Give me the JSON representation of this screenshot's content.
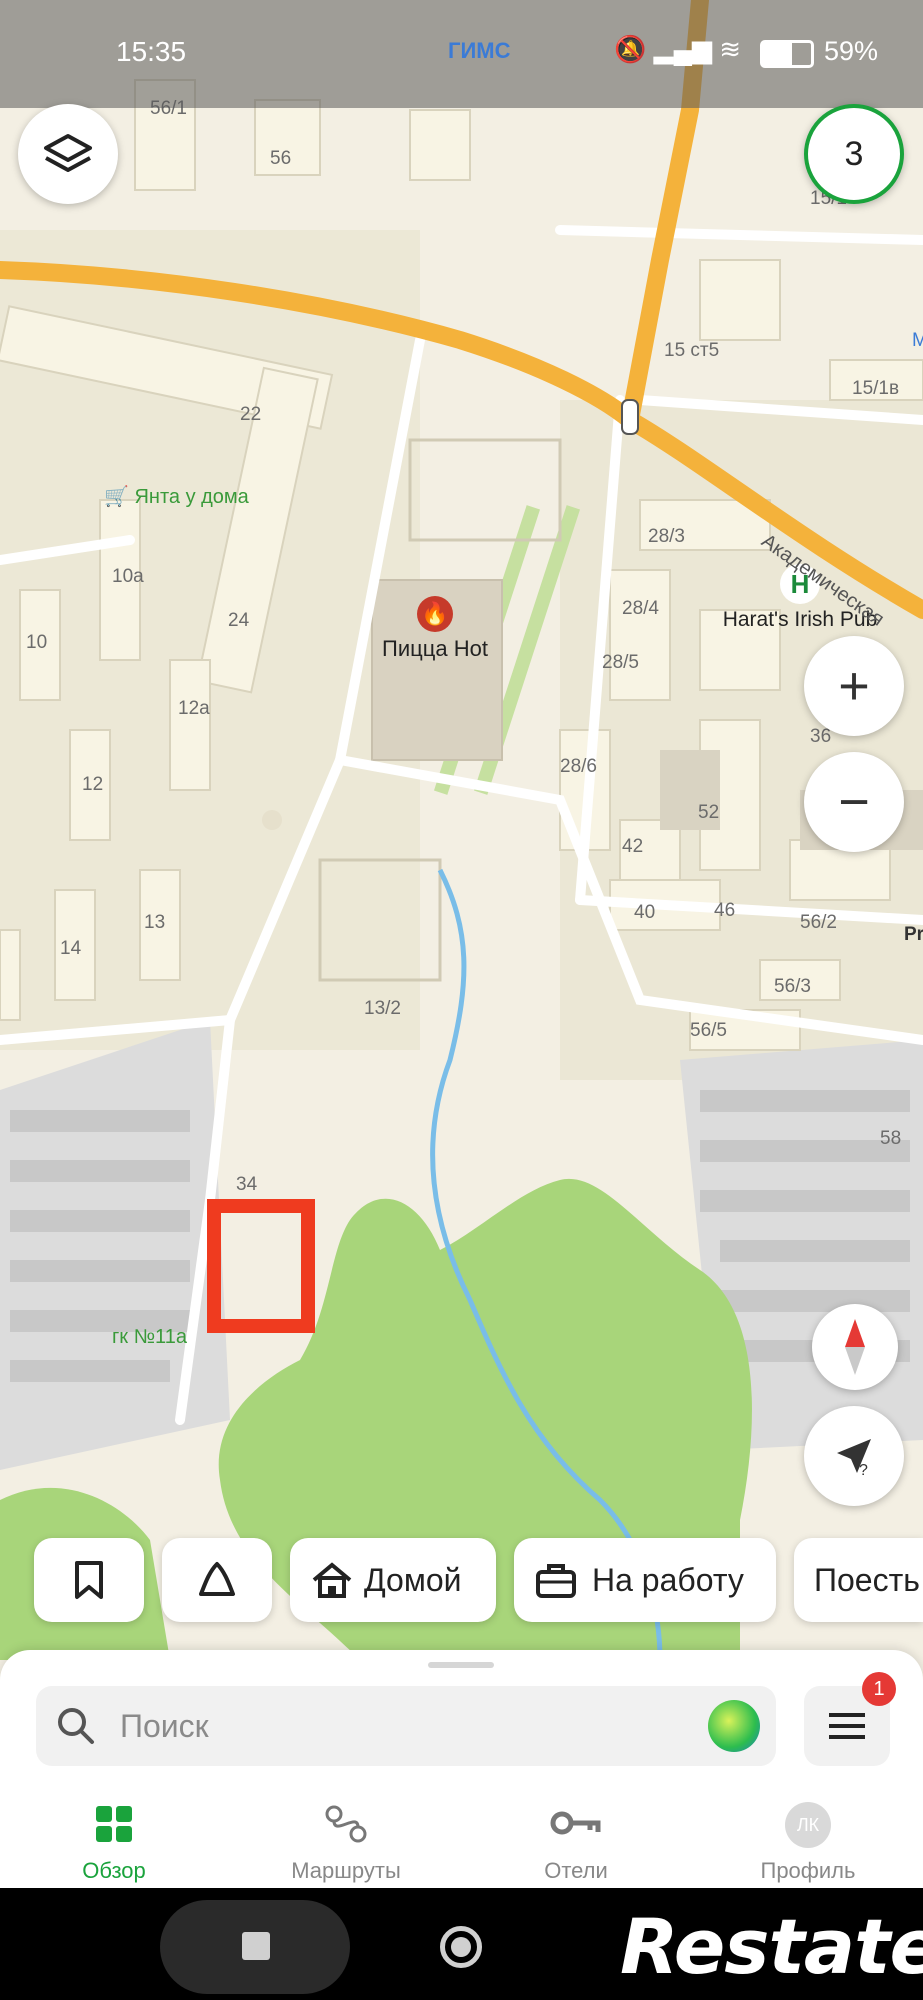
{
  "status_bar": {
    "time": "15:35",
    "center": "ГИМС",
    "battery": "59%"
  },
  "map": {
    "layers_button": "layers",
    "badge_count": "3",
    "zoom_in": "+",
    "zoom_out": "−",
    "street": "Академическая",
    "pois": [
      {
        "name": "Янта у дома",
        "color": "#3a9a3a"
      },
      {
        "name": "Пицца Hot",
        "color": "#222222"
      },
      {
        "name": "Harat's Irish Pub",
        "color": "#222222"
      },
      {
        "name": "гк №11а",
        "color": "#3a9a3a"
      }
    ],
    "house_numbers": [
      "56/1",
      "56",
      "15/1",
      "15 ст5",
      "15/1в",
      "22",
      "10а",
      "24",
      "10",
      "12а",
      "12",
      "13",
      "14",
      "13/2",
      "28/3",
      "28/4",
      "28/5",
      "28/6",
      "36",
      "52",
      "42",
      "40",
      "46",
      "56/2",
      "56/3",
      "56/5",
      "58",
      "34",
      "Pr",
      "М"
    ]
  },
  "chips": [
    {
      "label": "",
      "icon": "bookmark-icon"
    },
    {
      "label": "",
      "icon": "bell-icon"
    },
    {
      "label": "Домой",
      "icon": "home-icon"
    },
    {
      "label": "На работу",
      "icon": "briefcase-icon"
    },
    {
      "label": "Поесть",
      "icon": ""
    }
  ],
  "search": {
    "placeholder": "Поиск"
  },
  "menu": {
    "badge": "1"
  },
  "tabs": [
    {
      "label": "Обзор",
      "active": true
    },
    {
      "label": "Маршруты",
      "active": false
    },
    {
      "label": "Отели",
      "active": false
    },
    {
      "label": "Профиль",
      "active": false,
      "avatar": "ЛК"
    }
  ],
  "watermark": "Restate",
  "colors": {
    "accent_green": "#1aa33c",
    "road_orange": "#f4b23b",
    "park_green": "#a8d57a",
    "water_blue": "#79bde8",
    "marker_red": "#ef3b1f"
  }
}
